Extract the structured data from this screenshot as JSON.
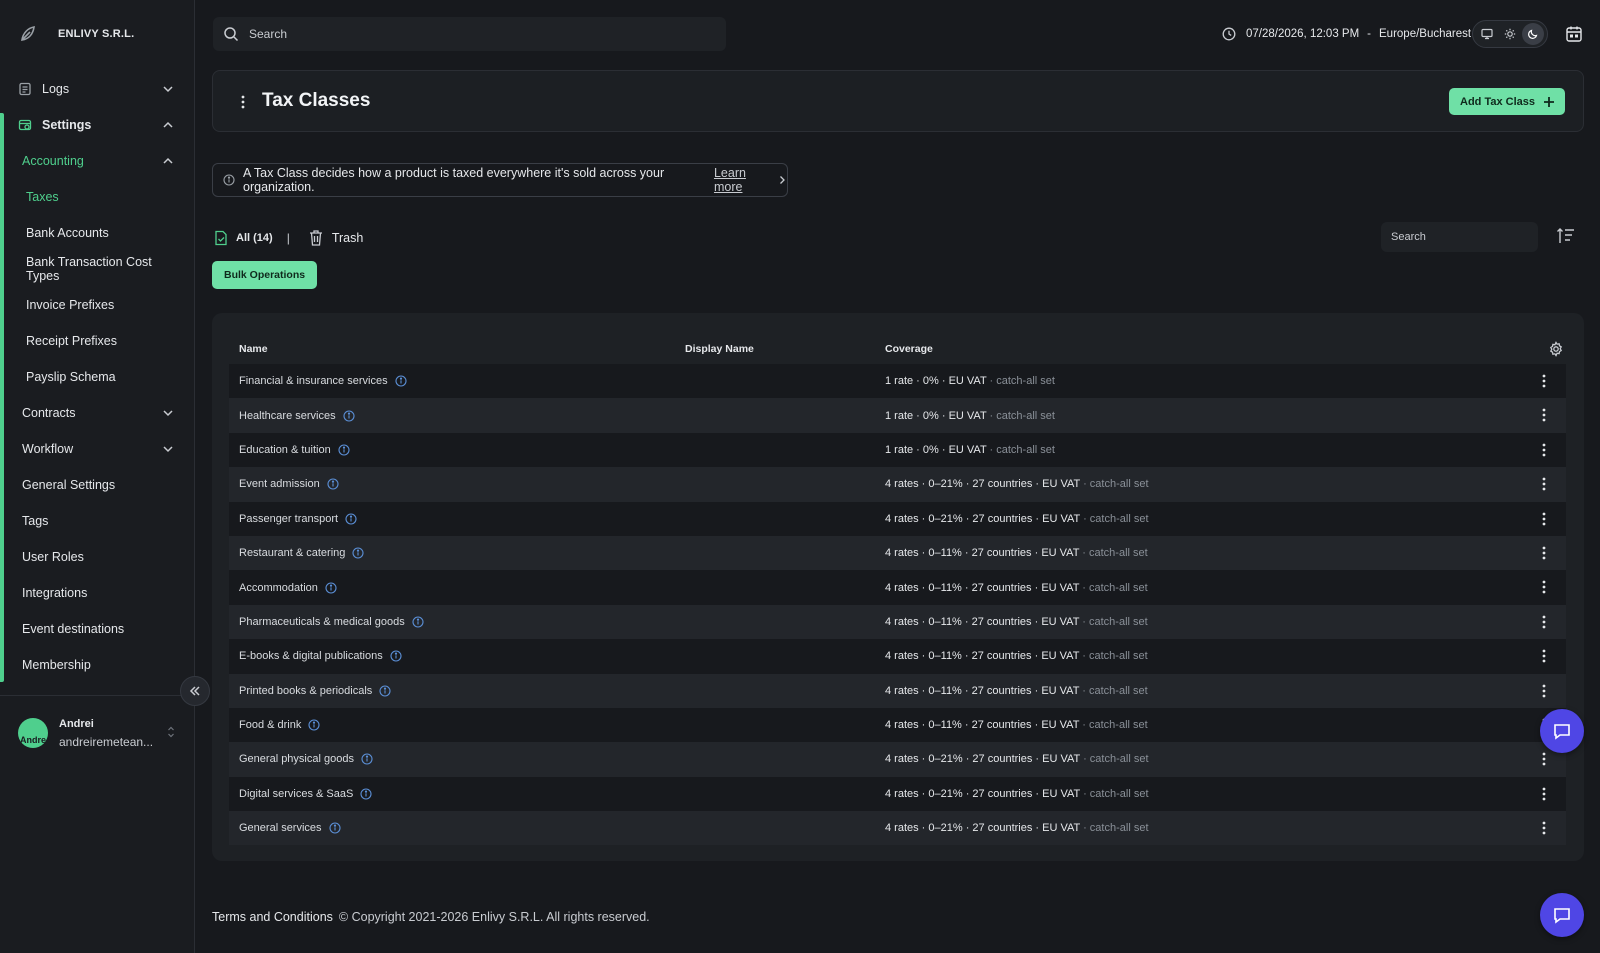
{
  "org": {
    "name": "ENLIVY S.R.L."
  },
  "sidebar": {
    "items": [
      {
        "label": "Logs"
      },
      {
        "label": "Settings"
      },
      {
        "label": "Accounting"
      },
      {
        "label": "Taxes"
      },
      {
        "label": "Bank Accounts"
      },
      {
        "label": "Bank Transaction Cost Types"
      },
      {
        "label": "Invoice Prefixes"
      },
      {
        "label": "Receipt Prefixes"
      },
      {
        "label": "Payslip Schema"
      },
      {
        "label": "Contracts"
      },
      {
        "label": "Workflow"
      },
      {
        "label": "General Settings"
      },
      {
        "label": "Tags"
      },
      {
        "label": "User Roles"
      },
      {
        "label": "Integrations"
      },
      {
        "label": "Event destinations"
      },
      {
        "label": "Membership"
      }
    ]
  },
  "user": {
    "name": "Andrei",
    "avatar_text": "Andre",
    "email": "andreiremetean..."
  },
  "topbar": {
    "search_placeholder": "Search",
    "datetime": "07/28/2026, 12:03 PM",
    "separator": "-",
    "timezone": "Europe/Bucharest"
  },
  "page": {
    "title": "Tax Classes",
    "add_button": "Add Tax Class",
    "info_text": "A Tax Class decides how a product is taxed everywhere it's sold across your organization.",
    "learn_more": "Learn more"
  },
  "filters": {
    "all": "All (14)",
    "separator": "|",
    "trash": "Trash",
    "search_placeholder": "Search",
    "bulk": "Bulk Operations"
  },
  "table": {
    "columns": {
      "name": "Name",
      "display_name": "Display Name",
      "coverage": "Coverage"
    },
    "rows": [
      {
        "name": "Financial & insurance services",
        "display_name": "",
        "coverage": "1 rate · 0% · EU VAT",
        "coverage_note": " · catch-all set"
      },
      {
        "name": "Healthcare services",
        "display_name": "",
        "coverage": "1 rate · 0% · EU VAT",
        "coverage_note": " · catch-all set"
      },
      {
        "name": "Education & tuition",
        "display_name": "",
        "coverage": "1 rate · 0% · EU VAT",
        "coverage_note": " · catch-all set"
      },
      {
        "name": "Event admission",
        "display_name": "",
        "coverage": "4 rates · 0–21% · 27 countries · EU VAT",
        "coverage_note": " · catch-all set"
      },
      {
        "name": "Passenger transport",
        "display_name": "",
        "coverage": "4 rates · 0–21% · 27 countries · EU VAT",
        "coverage_note": " · catch-all set"
      },
      {
        "name": "Restaurant & catering",
        "display_name": "",
        "coverage": "4 rates · 0–11% · 27 countries · EU VAT",
        "coverage_note": " · catch-all set"
      },
      {
        "name": "Accommodation",
        "display_name": "",
        "coverage": "4 rates · 0–11% · 27 countries · EU VAT",
        "coverage_note": " · catch-all set"
      },
      {
        "name": "Pharmaceuticals & medical goods",
        "display_name": "",
        "coverage": "4 rates · 0–11% · 27 countries · EU VAT",
        "coverage_note": " · catch-all set"
      },
      {
        "name": "E-books & digital publications",
        "display_name": "",
        "coverage": "4 rates · 0–11% · 27 countries · EU VAT",
        "coverage_note": " · catch-all set"
      },
      {
        "name": "Printed books & periodicals",
        "display_name": "",
        "coverage": "4 rates · 0–11% · 27 countries · EU VAT",
        "coverage_note": " · catch-all set"
      },
      {
        "name": "Food & drink",
        "display_name": "",
        "coverage": "4 rates · 0–11% · 27 countries · EU VAT",
        "coverage_note": " · catch-all set"
      },
      {
        "name": "General physical goods",
        "display_name": "",
        "coverage": "4 rates · 0–21% · 27 countries · EU VAT",
        "coverage_note": " · catch-all set"
      },
      {
        "name": "Digital services & SaaS",
        "display_name": "",
        "coverage": "4 rates · 0–21% · 27 countries · EU VAT",
        "coverage_note": " · catch-all set"
      },
      {
        "name": "General services",
        "display_name": "",
        "coverage": "4 rates · 0–21% · 27 countries · EU VAT",
        "coverage_note": " · catch-all set"
      }
    ]
  },
  "footer": {
    "terms": "Terms and Conditions",
    "copyright": "© Copyright 2021-2026 Enlivy S.R.L. All rights reserved."
  },
  "colors": {
    "accent": "#4fcf8d",
    "button_bg": "#6fe0a6",
    "chat": "#4f46e5",
    "background": "#17191d",
    "info_icon": "#5b8fd6"
  },
  "icons": {
    "logo": "leaf-logo-icon",
    "logs": "logs-icon",
    "settings": "settings-icon",
    "search": "search-icon",
    "clock": "clock-icon",
    "theme": [
      "monitor-icon",
      "sun-icon",
      "moon-icon"
    ],
    "calendar": "calendar-icon",
    "row_info": "info-icon",
    "row_menu": "kebab-menu-icon",
    "chat": "chat-icon"
  }
}
